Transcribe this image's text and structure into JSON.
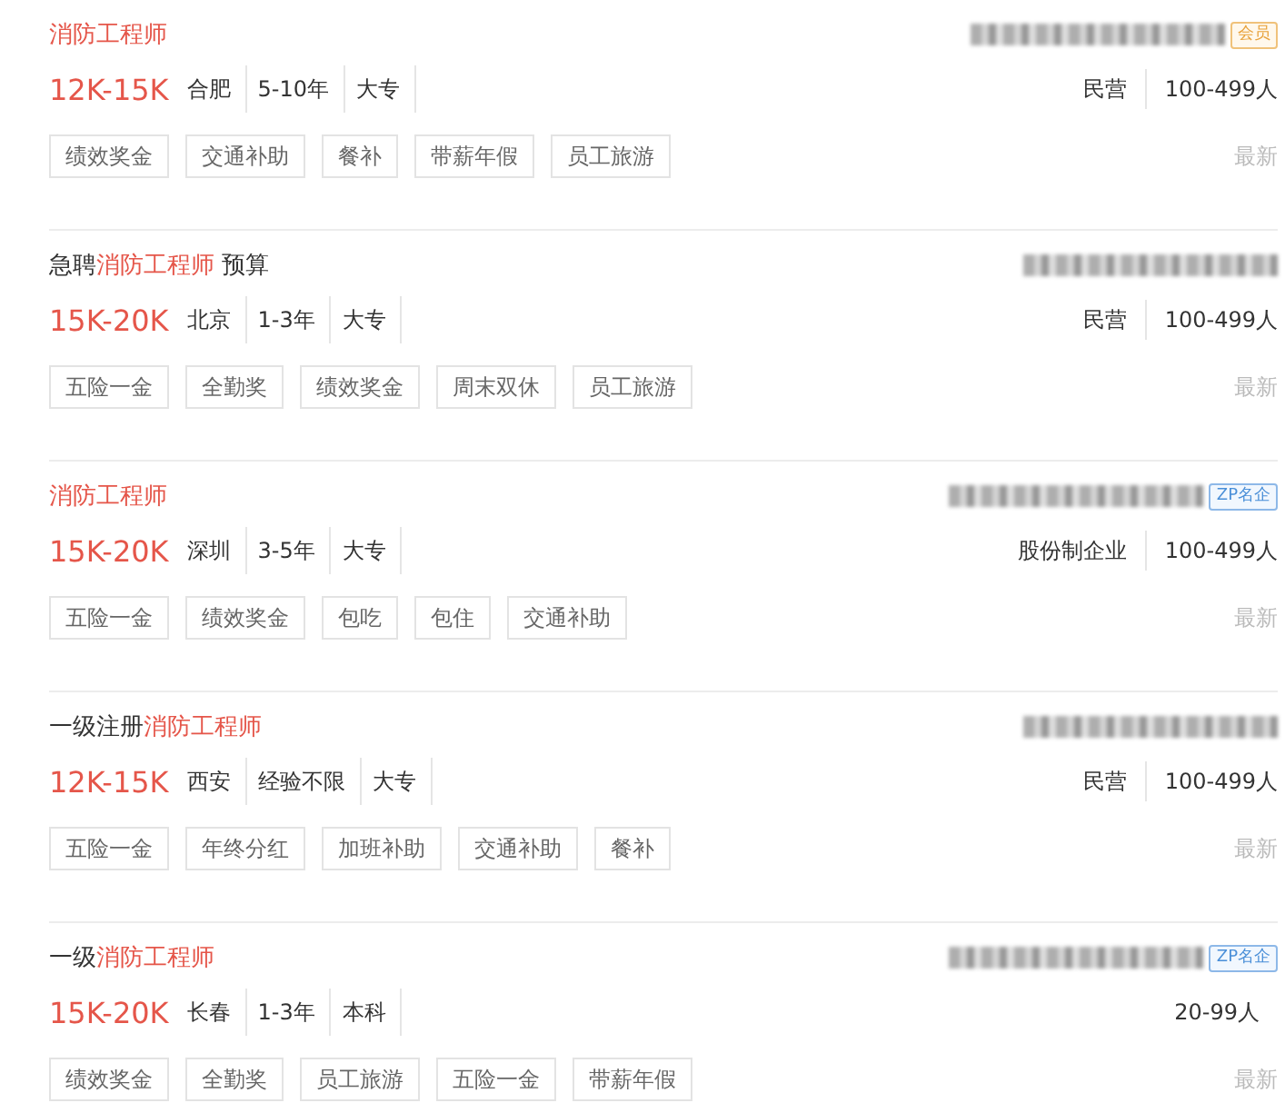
{
  "jobs": [
    {
      "title": [
        {
          "text": "消防工程师",
          "highlight": true
        }
      ],
      "badge": {
        "text": "会员",
        "kind": "member"
      },
      "salary": "12K-15K",
      "meta": [
        "合肥",
        "5-10年",
        "大专"
      ],
      "company": [
        "民营",
        "100-499人"
      ],
      "tags": [
        "绩效奖金",
        "交通补助",
        "餐补",
        "带薪年假",
        "员工旅游"
      ],
      "time": "最新"
    },
    {
      "title": [
        {
          "text": "急聘",
          "highlight": false
        },
        {
          "text": "消防工程师",
          "highlight": true
        },
        {
          "text": " 预算",
          "highlight": false
        }
      ],
      "salary": "15K-20K",
      "meta": [
        "北京",
        "1-3年",
        "大专"
      ],
      "company": [
        "民营",
        "100-499人"
      ],
      "tags": [
        "五险一金",
        "全勤奖",
        "绩效奖金",
        "周末双休",
        "员工旅游"
      ],
      "time": "最新"
    },
    {
      "title": [
        {
          "text": "消防工程师",
          "highlight": true
        }
      ],
      "badge": {
        "text": "ZP名企",
        "kind": "famous"
      },
      "salary": "15K-20K",
      "meta": [
        "深圳",
        "3-5年",
        "大专"
      ],
      "company": [
        "股份制企业",
        "100-499人"
      ],
      "tags": [
        "五险一金",
        "绩效奖金",
        "包吃",
        "包住",
        "交通补助"
      ],
      "time": "最新"
    },
    {
      "title": [
        {
          "text": "一级注册",
          "highlight": false
        },
        {
          "text": "消防工程师",
          "highlight": true
        }
      ],
      "salary": "12K-15K",
      "meta": [
        "西安",
        "经验不限",
        "大专"
      ],
      "company": [
        "民营",
        "100-499人"
      ],
      "tags": [
        "五险一金",
        "年终分红",
        "加班补助",
        "交通补助",
        "餐补"
      ],
      "time": "最新"
    },
    {
      "title": [
        {
          "text": "一级",
          "highlight": false
        },
        {
          "text": "消防工程师",
          "highlight": true
        }
      ],
      "badge": {
        "text": "ZP名企",
        "kind": "famous"
      },
      "salary": "15K-20K",
      "meta": [
        "长春",
        "1-3年",
        "本科"
      ],
      "company": [
        "20-99人"
      ],
      "tags": [
        "绩效奖金",
        "全勤奖",
        "员工旅游",
        "五险一金",
        "带薪年假"
      ],
      "time": "最新"
    }
  ]
}
